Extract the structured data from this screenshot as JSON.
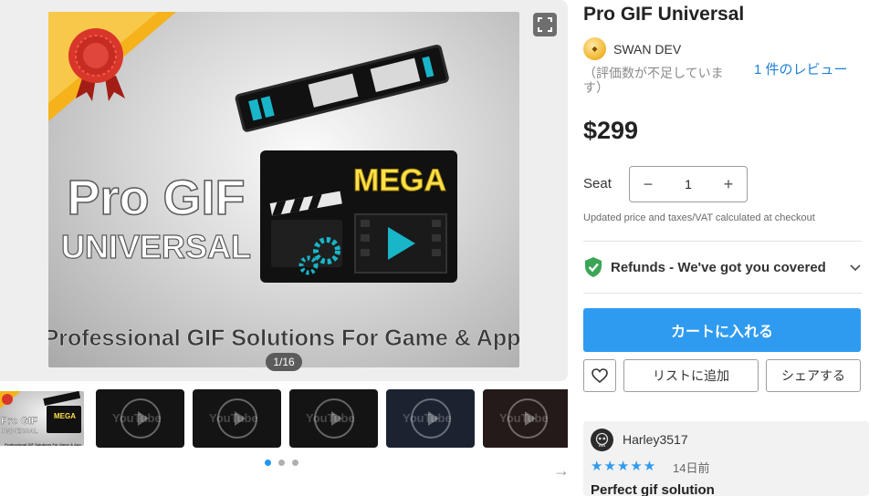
{
  "gallery": {
    "hero_title_line1": "Pro GIF",
    "hero_title_line2": "UNIVERSAL",
    "hero_badge_text": "MEGA",
    "hero_tagline": "Professional GIF Solutions For Game & App",
    "counter": "1/16",
    "thumbnails": [
      {
        "kind": "image",
        "line1": "Pro GIF",
        "line2": "UNIVERSAL",
        "badge": "MEGA",
        "tagline": "Professional GIF Solutions For Game & App"
      },
      {
        "kind": "video",
        "label": "YouTube"
      },
      {
        "kind": "video",
        "label": "YouTube"
      },
      {
        "kind": "video",
        "label": "YouTube"
      },
      {
        "kind": "video",
        "label": "YouTube"
      },
      {
        "kind": "video",
        "label": "YouTube"
      }
    ],
    "dots_total": 3,
    "dots_active": 0
  },
  "product": {
    "title": "Pro GIF Universal",
    "publisher": "SWAN DEV",
    "rating_note": "（評価数が不足しています）",
    "review_link": "1 件のレビュー",
    "price": "$299",
    "seat_label": "Seat",
    "seat_minus": "−",
    "seat_value": "1",
    "seat_plus": "+",
    "tax_note": "Updated price and taxes/VAT calculated at checkout",
    "refund_text": "Refunds - We've got you covered",
    "cart_button": "カートに入れる",
    "wishlist_button": "リストに追加",
    "share_button": "シェアする"
  },
  "review": {
    "user": "Harley3517",
    "stars": "★★★★★",
    "rating": 5,
    "date": "14日前",
    "title": "Perfect gif solution"
  },
  "colors": {
    "accent": "#2f9bf0",
    "shield": "#3aa655",
    "ribbon_gold": "#f5b21a",
    "ribbon_red": "#d9362b",
    "neon_yellow": "#ffe14a",
    "cyan": "#19b5c9"
  },
  "icons": {
    "expand": "expand-icon",
    "shield": "shield-check-icon",
    "chevron": "chevron-down-icon",
    "heart": "heart-icon",
    "next": "arrow-right-icon"
  }
}
